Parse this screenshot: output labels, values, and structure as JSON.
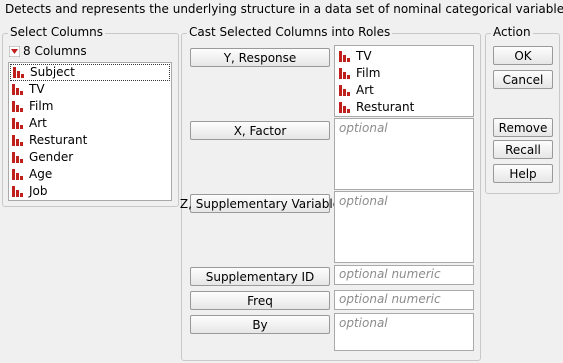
{
  "description": "Detects and represents the underlying structure in a data set of nominal categorical variables.",
  "select_columns": {
    "title": "Select Columns",
    "count_label": "8 Columns",
    "items": [
      "Subject",
      "TV",
      "Film",
      "Art",
      "Resturant",
      "Gender",
      "Age",
      "Job"
    ]
  },
  "cast": {
    "title": "Cast Selected Columns into Roles",
    "roles": [
      {
        "button": "Y, Response",
        "items": [
          "TV",
          "Film",
          "Art",
          "Resturant"
        ],
        "placeholder": ""
      },
      {
        "button": "X, Factor",
        "items": [],
        "placeholder": "optional"
      },
      {
        "button": "Z, Supplementary Variable",
        "items": [],
        "placeholder": "optional"
      },
      {
        "button": "Supplementary ID",
        "items": [],
        "placeholder": "optional numeric"
      },
      {
        "button": "Freq",
        "items": [],
        "placeholder": "optional numeric"
      },
      {
        "button": "By",
        "items": [],
        "placeholder": "optional"
      }
    ]
  },
  "action": {
    "title": "Action",
    "buttons": [
      "OK",
      "Cancel",
      "Remove",
      "Recall",
      "Help"
    ]
  },
  "colors": {
    "bar_icon": "#c0201b",
    "arrow_icon": "#c0201b",
    "group_border": "#c8c8c8"
  }
}
